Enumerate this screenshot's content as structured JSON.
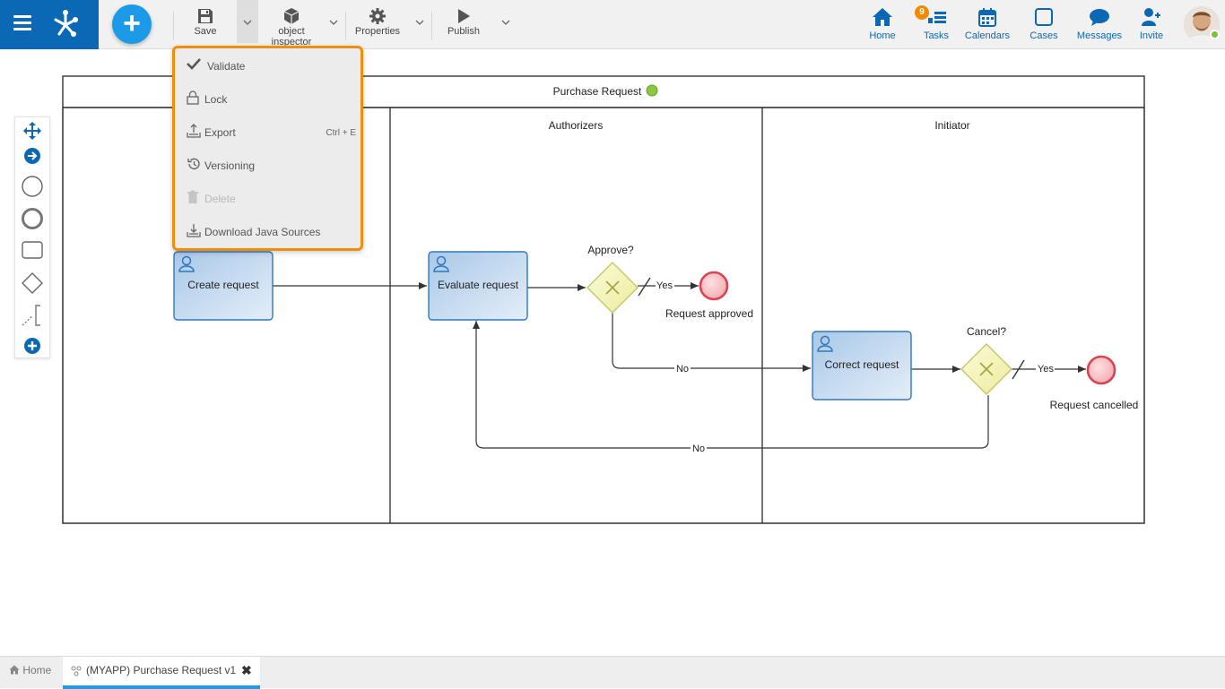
{
  "toolbar": {
    "save_label": "Save",
    "object_inspector_line1": "object",
    "object_inspector_line2": "inspector",
    "properties_label": "Properties",
    "publish_label": "Publish"
  },
  "nav": {
    "home": "Home",
    "tasks": "Tasks",
    "tasks_badge": "9",
    "calendars": "Calendars",
    "cases": "Cases",
    "messages": "Messages",
    "invite": "Invite"
  },
  "menu": {
    "validate": "Validate",
    "lock": "Lock",
    "export": "Export",
    "export_shortcut": "Ctrl + E",
    "versioning": "Versioning",
    "delete": "Delete",
    "download": "Download Java Sources"
  },
  "process": {
    "title": "Purchase Request",
    "lanes": [
      "",
      "Authorizers",
      "Initiator"
    ],
    "tasks": {
      "create": "Create request",
      "evaluate": "Evaluate request",
      "correct": "Correct request"
    },
    "gateways": {
      "approve": "Approve?",
      "cancel": "Cancel?"
    },
    "events": {
      "approved": "Request approved",
      "cancelled": "Request cancelled"
    },
    "flows": {
      "yes1": "Yes",
      "no1": "No",
      "yes2": "Yes",
      "no2": "No"
    }
  },
  "tabs": {
    "home": "Home",
    "active": "(MYAPP) Purchase Request v1"
  },
  "colors": {
    "brand": "#0b68b4",
    "accent": "#1c9ae8",
    "menu_border": "#f28c0f",
    "task_fill": "#bcd6ef",
    "gateway_fill": "#f3f3b7",
    "end_event": "#d94452",
    "status_dot": "#8cc63e"
  }
}
